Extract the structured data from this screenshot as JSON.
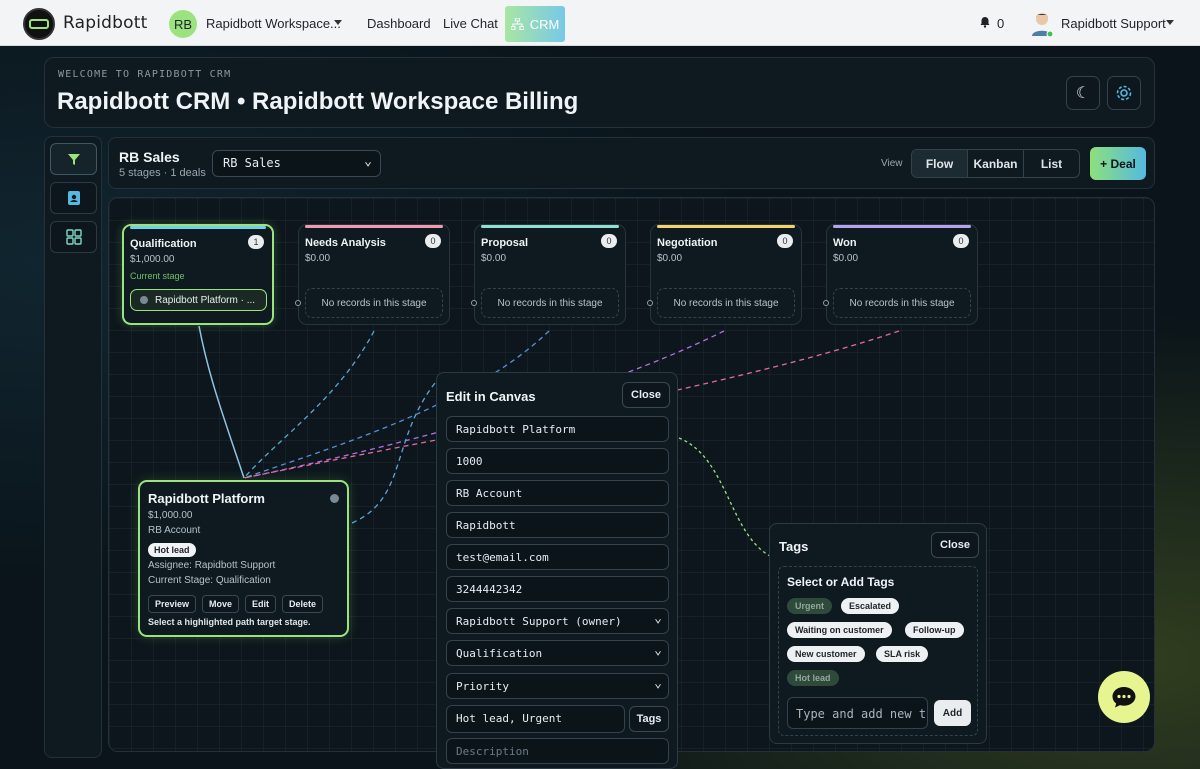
{
  "topbar": {
    "brand": "Rapidbott",
    "workspace_initials": "RB",
    "workspace_name": "Rapidbott Workspace...",
    "nav": {
      "dashboard": "Dashboard",
      "live_chat": "Live Chat",
      "crm": "CRM"
    },
    "notification_count": "0",
    "user_name": "Rapidbott Support"
  },
  "header": {
    "welcome": "WELCOME TO RAPIDBOTT CRM",
    "title": "Rapidbott CRM • Rapidbott Workspace Billing"
  },
  "toolbar": {
    "pipeline_name": "RB Sales",
    "pipeline_meta": "5 stages · 1 deals",
    "pipeline_select": "RB Sales",
    "view_label": "View",
    "views": {
      "flow": "Flow",
      "kanban": "Kanban",
      "list": "List"
    },
    "add_deal": "+ Deal"
  },
  "stages": [
    {
      "title": "Qualification",
      "count": "1",
      "amount": "$1,000.00",
      "current_label": "Current stage",
      "deal_chip": "Rapidbott Platform · ...",
      "color": "#6fd3e8"
    },
    {
      "title": "Needs Analysis",
      "count": "0",
      "amount": "$0.00",
      "empty": "No records in this stage",
      "color": "#f29bb0"
    },
    {
      "title": "Proposal",
      "count": "0",
      "amount": "$0.00",
      "empty": "No records in this stage",
      "color": "#8fe0d2"
    },
    {
      "title": "Negotiation",
      "count": "0",
      "amount": "$0.00",
      "empty": "No records in this stage",
      "color": "#f3d36b"
    },
    {
      "title": "Won",
      "count": "0",
      "amount": "$0.00",
      "empty": "No records in this stage",
      "color": "#b7a2f0"
    }
  ],
  "card": {
    "title": "Rapidbott Platform",
    "amount": "$1,000.00",
    "account": "RB Account",
    "tag": "Hot lead",
    "assignee": "Assignee: Rapidbott Support",
    "current_stage": "Current Stage: Qualification",
    "actions": {
      "preview": "Preview",
      "move": "Move",
      "edit": "Edit",
      "delete": "Delete"
    },
    "hint": "Select a highlighted path target stage."
  },
  "edit_panel": {
    "title": "Edit in Canvas",
    "close": "Close",
    "deal_name": "Rapidbott Platform",
    "amount": "1000",
    "account": "RB Account",
    "company": "Rapidbott",
    "email": "test@email.com",
    "phone": "3244442342",
    "owner": "Rapidbott Support (owner)",
    "stage": "Qualification",
    "priority": "Priority",
    "tags_value": "Hot lead, Urgent",
    "tags_button": "Tags",
    "description_placeholder": "Description"
  },
  "tags_panel": {
    "title": "Tags",
    "close": "Close",
    "subtitle": "Select or Add Tags",
    "tags": [
      "Urgent",
      "Escalated",
      "Waiting on customer",
      "Follow-up",
      "New customer",
      "SLA risk",
      "Hot lead"
    ],
    "input_placeholder": "Type and add new t",
    "add": "Add"
  },
  "colors": {
    "accent_green": "#9be37f",
    "accent_blue": "#55b9e0",
    "background": "#0b141b"
  }
}
